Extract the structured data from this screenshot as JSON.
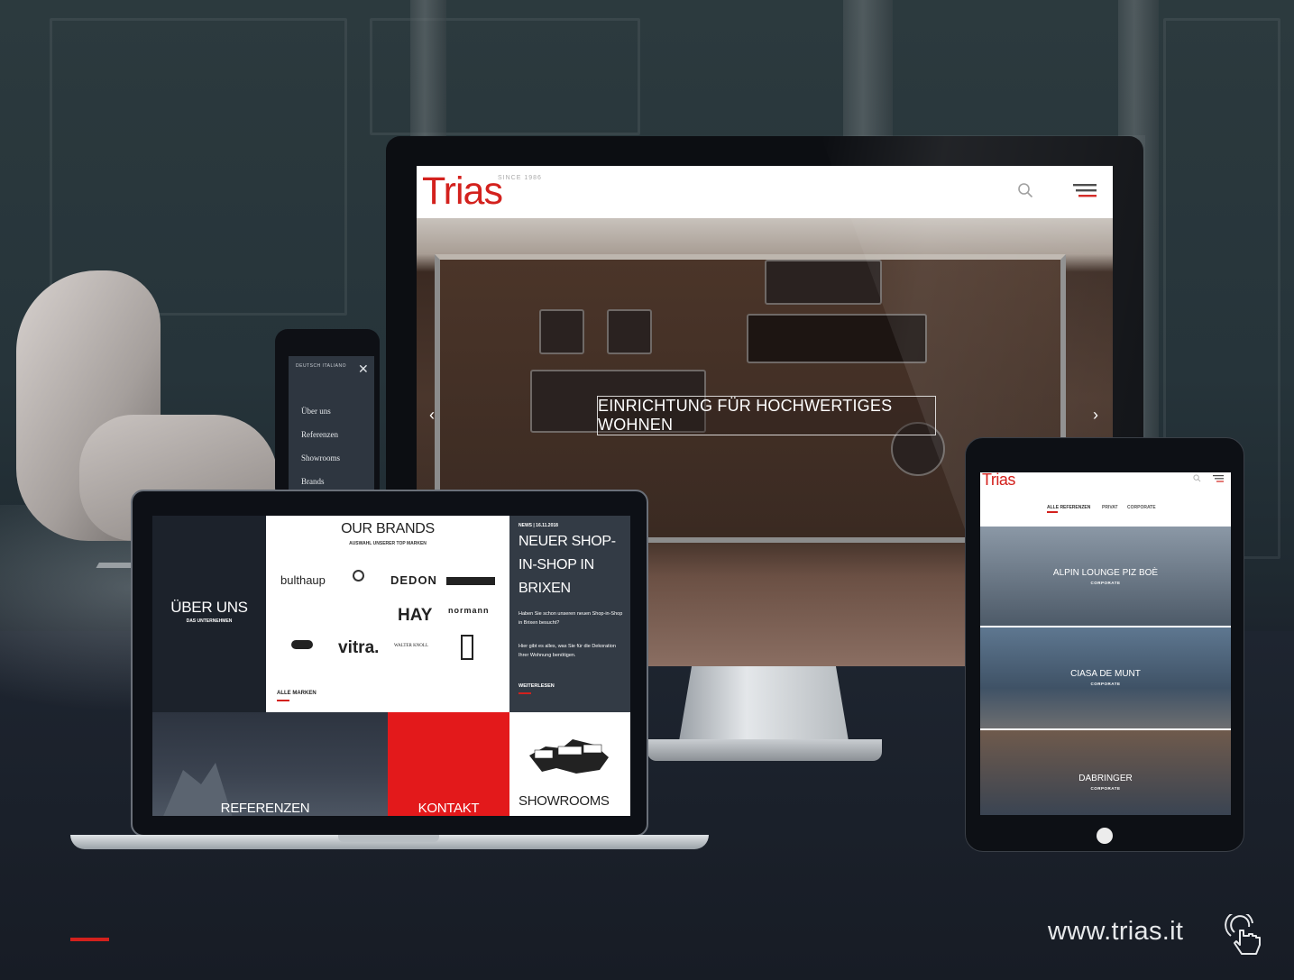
{
  "desktop": {
    "logo": "Trias",
    "since": "SINCE 1986",
    "hero_caption": "EINRICHTUNG FÜR HOCHWERTIGES WOHNEN",
    "prev_arrow": "‹",
    "next_arrow": "›"
  },
  "phone": {
    "languages": "DEUTSCH    ITALIANO",
    "close": "✕",
    "menu_items": [
      "Über uns",
      "Referenzen",
      "Showrooms",
      "Brands"
    ]
  },
  "laptop": {
    "about": {
      "title": "ÜBER UNS",
      "subtitle": "DAS UNTERNEHMEN"
    },
    "brands": {
      "title": "OUR BRANDS",
      "subtitle": "AUSWAHL UNSERER TOP MARKEN",
      "logos": [
        "bulthaup",
        "DEDON",
        "HAY",
        "normann",
        "vitra.",
        "WALTER KNOLL"
      ],
      "all_link": "ALLE MARKEN"
    },
    "news": {
      "meta": "NEWS | 16.11.2018",
      "title_lines": [
        "NEUER SHOP-",
        "IN-SHOP IN",
        "BRIXEN"
      ],
      "body1": "Haben Sie schon unseren neuen Shop-in-Shop in Brixen besucht?",
      "body2": "Hier gibt es alles, was Sie für die Dekoration Ihrer Wohnung benötigen.",
      "read_more": "WEITERLESEN"
    },
    "referenzen": "REFERENZEN",
    "kontakt": "KONTAKT",
    "showrooms": "SHOWROOMS"
  },
  "tablet": {
    "logo": "Trias",
    "filters": [
      "ALLE REFERENZEN",
      "PRIVAT",
      "CORPORATE"
    ],
    "cards": [
      {
        "title": "ALPIN LOUNGE PIZ BOÈ",
        "category": "CORPORATE"
      },
      {
        "title": "CIASA DE MUNT",
        "category": "CORPORATE"
      },
      {
        "title": "DABRINGER",
        "category": "CORPORATE"
      }
    ]
  },
  "footer": {
    "url": "www.trias.it"
  },
  "colors": {
    "brand_red": "#d3211d",
    "background_dark": "#1a1f29"
  }
}
